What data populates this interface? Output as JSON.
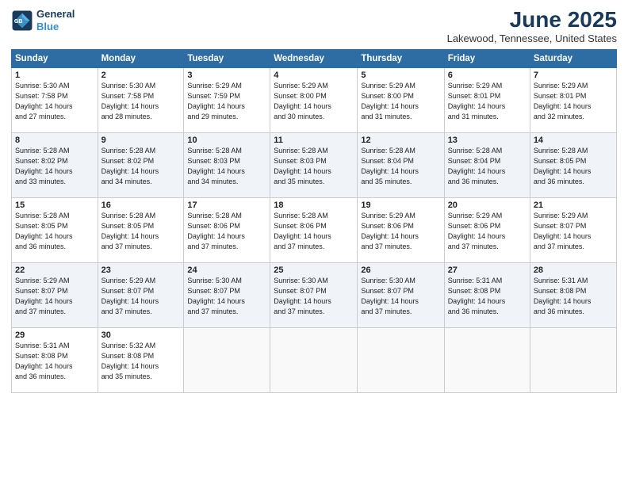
{
  "logo": {
    "line1": "General",
    "line2": "Blue"
  },
  "title": "June 2025",
  "location": "Lakewood, Tennessee, United States",
  "days_of_week": [
    "Sunday",
    "Monday",
    "Tuesday",
    "Wednesday",
    "Thursday",
    "Friday",
    "Saturday"
  ],
  "weeks": [
    [
      {
        "day": "1",
        "sunrise": "5:30 AM",
        "sunset": "7:58 PM",
        "daylight": "14 hours and 27 minutes."
      },
      {
        "day": "2",
        "sunrise": "5:30 AM",
        "sunset": "7:58 PM",
        "daylight": "14 hours and 28 minutes."
      },
      {
        "day": "3",
        "sunrise": "5:29 AM",
        "sunset": "7:59 PM",
        "daylight": "14 hours and 29 minutes."
      },
      {
        "day": "4",
        "sunrise": "5:29 AM",
        "sunset": "8:00 PM",
        "daylight": "14 hours and 30 minutes."
      },
      {
        "day": "5",
        "sunrise": "5:29 AM",
        "sunset": "8:00 PM",
        "daylight": "14 hours and 31 minutes."
      },
      {
        "day": "6",
        "sunrise": "5:29 AM",
        "sunset": "8:01 PM",
        "daylight": "14 hours and 31 minutes."
      },
      {
        "day": "7",
        "sunrise": "5:29 AM",
        "sunset": "8:01 PM",
        "daylight": "14 hours and 32 minutes."
      }
    ],
    [
      {
        "day": "8",
        "sunrise": "5:28 AM",
        "sunset": "8:02 PM",
        "daylight": "14 hours and 33 minutes."
      },
      {
        "day": "9",
        "sunrise": "5:28 AM",
        "sunset": "8:02 PM",
        "daylight": "14 hours and 34 minutes."
      },
      {
        "day": "10",
        "sunrise": "5:28 AM",
        "sunset": "8:03 PM",
        "daylight": "14 hours and 34 minutes."
      },
      {
        "day": "11",
        "sunrise": "5:28 AM",
        "sunset": "8:03 PM",
        "daylight": "14 hours and 35 minutes."
      },
      {
        "day": "12",
        "sunrise": "5:28 AM",
        "sunset": "8:04 PM",
        "daylight": "14 hours and 35 minutes."
      },
      {
        "day": "13",
        "sunrise": "5:28 AM",
        "sunset": "8:04 PM",
        "daylight": "14 hours and 36 minutes."
      },
      {
        "day": "14",
        "sunrise": "5:28 AM",
        "sunset": "8:05 PM",
        "daylight": "14 hours and 36 minutes."
      }
    ],
    [
      {
        "day": "15",
        "sunrise": "5:28 AM",
        "sunset": "8:05 PM",
        "daylight": "14 hours and 36 minutes."
      },
      {
        "day": "16",
        "sunrise": "5:28 AM",
        "sunset": "8:05 PM",
        "daylight": "14 hours and 37 minutes."
      },
      {
        "day": "17",
        "sunrise": "5:28 AM",
        "sunset": "8:06 PM",
        "daylight": "14 hours and 37 minutes."
      },
      {
        "day": "18",
        "sunrise": "5:28 AM",
        "sunset": "8:06 PM",
        "daylight": "14 hours and 37 minutes."
      },
      {
        "day": "19",
        "sunrise": "5:29 AM",
        "sunset": "8:06 PM",
        "daylight": "14 hours and 37 minutes."
      },
      {
        "day": "20",
        "sunrise": "5:29 AM",
        "sunset": "8:06 PM",
        "daylight": "14 hours and 37 minutes."
      },
      {
        "day": "21",
        "sunrise": "5:29 AM",
        "sunset": "8:07 PM",
        "daylight": "14 hours and 37 minutes."
      }
    ],
    [
      {
        "day": "22",
        "sunrise": "5:29 AM",
        "sunset": "8:07 PM",
        "daylight": "14 hours and 37 minutes."
      },
      {
        "day": "23",
        "sunrise": "5:29 AM",
        "sunset": "8:07 PM",
        "daylight": "14 hours and 37 minutes."
      },
      {
        "day": "24",
        "sunrise": "5:30 AM",
        "sunset": "8:07 PM",
        "daylight": "14 hours and 37 minutes."
      },
      {
        "day": "25",
        "sunrise": "5:30 AM",
        "sunset": "8:07 PM",
        "daylight": "14 hours and 37 minutes."
      },
      {
        "day": "26",
        "sunrise": "5:30 AM",
        "sunset": "8:07 PM",
        "daylight": "14 hours and 37 minutes."
      },
      {
        "day": "27",
        "sunrise": "5:31 AM",
        "sunset": "8:08 PM",
        "daylight": "14 hours and 36 minutes."
      },
      {
        "day": "28",
        "sunrise": "5:31 AM",
        "sunset": "8:08 PM",
        "daylight": "14 hours and 36 minutes."
      }
    ],
    [
      {
        "day": "29",
        "sunrise": "5:31 AM",
        "sunset": "8:08 PM",
        "daylight": "14 hours and 36 minutes."
      },
      {
        "day": "30",
        "sunrise": "5:32 AM",
        "sunset": "8:08 PM",
        "daylight": "14 hours and 35 minutes."
      },
      null,
      null,
      null,
      null,
      null
    ]
  ]
}
